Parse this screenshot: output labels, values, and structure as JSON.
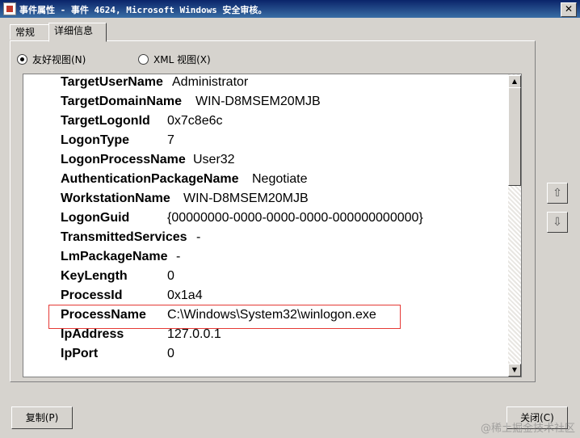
{
  "window": {
    "title": "事件属性 - 事件 4624, Microsoft Windows 安全审核。",
    "close_glyph": "✕"
  },
  "tabs": [
    {
      "label": "常规"
    },
    {
      "label": "详细信息"
    }
  ],
  "view_options": [
    {
      "label": "友好视图(N)",
      "selected": true
    },
    {
      "label": "XML 视图(X)",
      "selected": false
    }
  ],
  "details": [
    {
      "key": "TargetUserName",
      "value": "Administrator"
    },
    {
      "key": "TargetDomainName",
      "value": "WIN-D8MSEM20MJB"
    },
    {
      "key": "TargetLogonId",
      "value": "0x7c8e6c"
    },
    {
      "key": "LogonType",
      "value": "7"
    },
    {
      "key": "LogonProcessName",
      "value": "User32"
    },
    {
      "key": "AuthenticationPackageName",
      "value": "Negotiate"
    },
    {
      "key": "WorkstationName",
      "value": "WIN-D8MSEM20MJB"
    },
    {
      "key": "LogonGuid",
      "value": "{00000000-0000-0000-0000-000000000000}"
    },
    {
      "key": "TransmittedServices",
      "value": "-"
    },
    {
      "key": "LmPackageName",
      "value": "-"
    },
    {
      "key": "KeyLength",
      "value": "0"
    },
    {
      "key": "ProcessId",
      "value": "0x1a4"
    },
    {
      "key": "ProcessName",
      "value": "C:\\Windows\\System32\\winlogon.exe"
    },
    {
      "key": "IpAddress",
      "value": "127.0.0.1"
    },
    {
      "key": "IpPort",
      "value": "0"
    }
  ],
  "buttons": {
    "copy": "复制(P)",
    "close": "关闭(C)"
  },
  "watermark": "@稀土掘金技术社区",
  "icons": {
    "scroll_up": "▲",
    "scroll_down": "▼",
    "prev": "⇧",
    "next": "⇩"
  },
  "colors": {
    "highlight": "#e53935",
    "titlebar": "#0a246a"
  }
}
